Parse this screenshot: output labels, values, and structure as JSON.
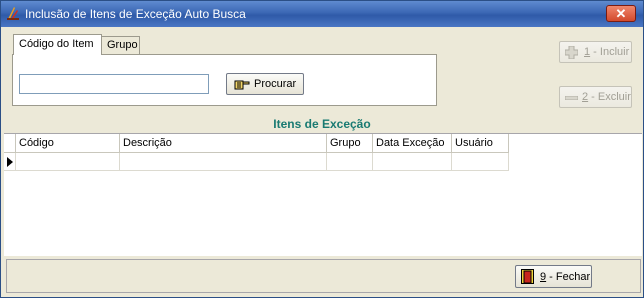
{
  "window": {
    "title": "Inclusão de Itens de Exceção Auto Busca",
    "close_label": "✕"
  },
  "tabs": [
    {
      "label": "Código do Item",
      "active": true
    },
    {
      "label": "Grupo",
      "active": false
    }
  ],
  "search": {
    "value": "",
    "button_label": "Procurar"
  },
  "actions": {
    "include": {
      "key": "1",
      "label": " - Incluir",
      "enabled": false
    },
    "exclude": {
      "key": "2",
      "label": " - Excluir",
      "enabled": false
    },
    "close": {
      "key": "9",
      "label": " - Fechar"
    }
  },
  "section": {
    "title": "Itens de Exceção"
  },
  "grid": {
    "columns": [
      "Código",
      "Descrição",
      "Grupo",
      "Data Exceção",
      "Usuário"
    ],
    "rows": [
      [
        "",
        "",
        "",
        "",
        ""
      ]
    ]
  },
  "colors": {
    "accent": "#197a72",
    "titlebar": "#3b67b4"
  }
}
